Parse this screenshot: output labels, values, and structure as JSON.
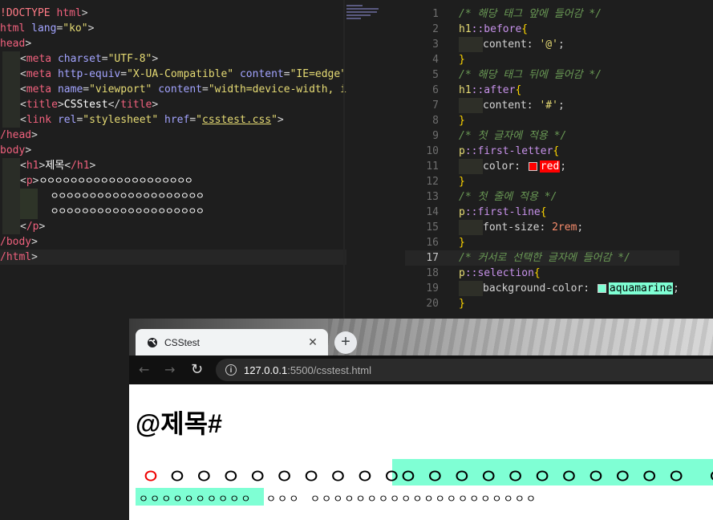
{
  "html_editor": {
    "l1": {
      "a": "!DOCTYPE",
      "b": " html",
      "c": ">"
    },
    "l2": {
      "tag": "html",
      "attr": "lang",
      "val": "\"ko\""
    },
    "l3": {
      "tag": "head"
    },
    "l4": {
      "tag": "meta",
      "attr": "charset",
      "val": "\"UTF-8\""
    },
    "l5": {
      "tag": "meta",
      "attr1": "http-equiv",
      "val1": "\"X-UA-Compatible\"",
      "attr2": "content",
      "val2": "\"IE=edge\""
    },
    "l6": {
      "tag": "meta",
      "attr1": "name",
      "val1": "\"viewport\"",
      "attr2": "content",
      "val2": "\"width=device-width, i"
    },
    "l7": {
      "tag": "title",
      "text": "CSStest",
      "close": "title"
    },
    "l8": {
      "tag": "link",
      "attr1": "rel",
      "val1": "\"stylesheet\"",
      "attr2": "href",
      "val2q": "\"",
      "val2": "csstest.css",
      "val2e": "\""
    },
    "l9": {
      "tag": "/head"
    },
    "l10": {
      "tag": "body"
    },
    "l11": {
      "tag": "h1",
      "text": "제목",
      "close": "/h1"
    },
    "l12": {
      "tag": "p",
      "text": "ㅇㅇㅇㅇㅇㅇㅇㅇㅇㅇㅇㅇㅇㅇㅇㅇㅇㅇㅇㅇ"
    },
    "l13": {
      "text": "ㅇㅇㅇㅇㅇㅇㅇㅇㅇㅇㅇㅇㅇㅇㅇㅇㅇㅇㅇㅇ"
    },
    "l14": {
      "text": "ㅇㅇㅇㅇㅇㅇㅇㅇㅇㅇㅇㅇㅇㅇㅇㅇㅇㅇㅇㅇ"
    },
    "l15": {
      "tag": "/p"
    },
    "l16": {
      "tag": "/body"
    },
    "l17": {
      "tag": "/html"
    }
  },
  "css_editor": {
    "lines": [
      {
        "n": "1",
        "comment": "/* 해당 태그 앞에 들어감 */"
      },
      {
        "n": "2",
        "sel": "h1",
        "pseudo": "::before",
        "brace": "{"
      },
      {
        "n": "3",
        "prop": "content: ",
        "val": "'@'",
        "end": ";"
      },
      {
        "n": "4",
        "brace": "}"
      },
      {
        "n": "5",
        "comment": "/* 해당 태그 뒤에 들어감 */"
      },
      {
        "n": "6",
        "sel": "h1",
        "pseudo": "::after",
        "brace": "{"
      },
      {
        "n": "7",
        "prop": "content: ",
        "val": "'#'",
        "end": ";"
      },
      {
        "n": "8",
        "brace": "}"
      },
      {
        "n": "9",
        "comment": "/* 첫 글자에 적용 */"
      },
      {
        "n": "10",
        "sel": "p",
        "pseudo": "::first-letter",
        "brace": "{"
      },
      {
        "n": "11",
        "prop": "color: ",
        "color_val": "red",
        "end": ";"
      },
      {
        "n": "12",
        "brace": "}"
      },
      {
        "n": "13",
        "comment": "/* 첫 줄에 적용 */"
      },
      {
        "n": "14",
        "sel": "p",
        "pseudo": "::first-line",
        "brace": "{"
      },
      {
        "n": "15",
        "prop": "font-size: ",
        "num": "2rem",
        "end": ";"
      },
      {
        "n": "16",
        "brace": "}"
      },
      {
        "n": "17",
        "comment": "/* 커서로 선택한 글자에 들어감 */"
      },
      {
        "n": "18",
        "sel": "p",
        "pseudo": "::selection",
        "brace": "{"
      },
      {
        "n": "19",
        "prop": "background-color: ",
        "color_val2": "aquamarine",
        "end": ";"
      },
      {
        "n": "20",
        "brace": "}"
      }
    ]
  },
  "browser": {
    "tab_title": "CSStest",
    "tab_close": "✕",
    "new_tab": "+",
    "url_host": "127.0.0.1",
    "url_rest": ":5500/csstest.html",
    "back": "←",
    "forward": "→",
    "reload": "↻",
    "info": "i"
  },
  "page": {
    "h1": "@제목#",
    "p_line1_first": "ㅇ",
    "p_line1_plain": "ㅇㅇㅇㅇㅇㅇㅇㅇㅇ",
    "p_line1_selected": "ㅇㅇㅇㅇㅇㅇㅇㅇㅇㅇㅇ ㅇ",
    "p_line2_selected": "ㅇㅇㅇㅇㅇㅇㅇㅇㅇㅇ",
    "p_line2_a": "ㅇㅇㅇ",
    "p_line2_b": "ㅇㅇㅇㅇㅇㅇㅇㅇㅇㅇㅇㅇㅇㅇㅇㅇㅇㅇㅇㅇ"
  },
  "colors": {
    "aquamarine": "#7fffd4",
    "red": "#ff0000"
  }
}
